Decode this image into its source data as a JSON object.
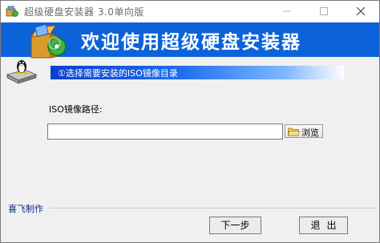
{
  "window": {
    "title": "超级硬盘安装器 3.0单向版"
  },
  "banner": {
    "title": "欢迎使用超级硬盘安装器"
  },
  "step": {
    "text": "①选择需要安装的ISO镜像目录"
  },
  "form": {
    "path_label": "ISO镜像路径:",
    "path_value": "",
    "browse_label": "浏览"
  },
  "footer": {
    "brand": "喜飞制作",
    "next_label": "下一步",
    "exit_label": "退出"
  },
  "colors": {
    "banner": "#0c63d9",
    "step_bar_start": "#0a3fd0",
    "brand_text": "#0d2a8c"
  }
}
